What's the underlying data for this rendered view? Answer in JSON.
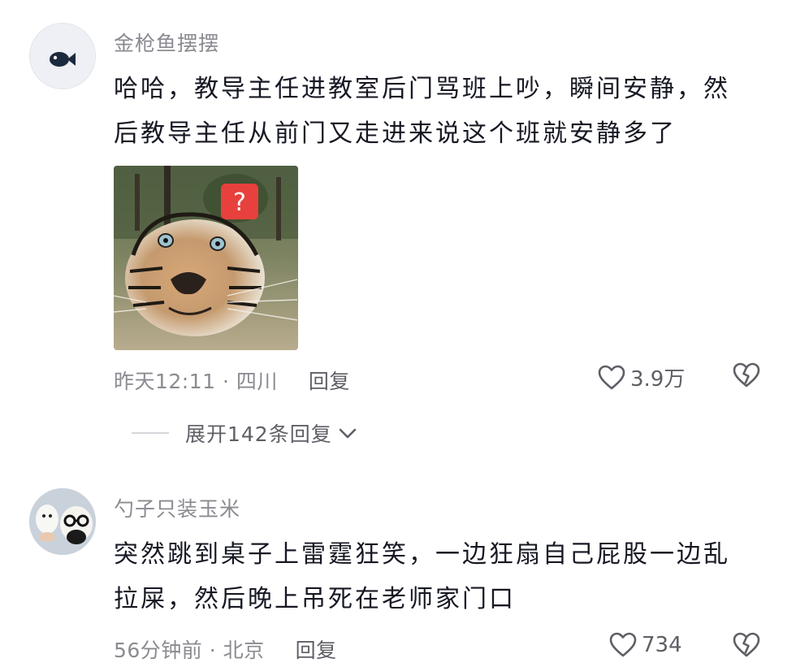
{
  "comments": [
    {
      "username": "金枪鱼摆摆",
      "text_line1": "哈哈，教导主任进教室后门骂班上吵，瞬间安静，然",
      "text_line2": "后教导主任从前门又走进来说这个班就安静多了",
      "sticker_badge": "?",
      "time_location": "昨天12:11 · 四川",
      "reply_label": "回复",
      "likes": "3.9万",
      "expand_replies": "展开142条回复"
    },
    {
      "username": "勺子只装玉米",
      "text_line1": "突然跳到桌子上雷霆狂笑，一边狂扇自己屁股一边乱",
      "text_line2": "拉屎，然后晚上吊死在老师家门口",
      "time_location": "56分钟前 · 北京",
      "reply_label": "回复",
      "likes": "734"
    }
  ],
  "colors": {
    "badge": "#e8403c",
    "meta": "#8a8b91"
  },
  "icons": [
    "fish-avatar-icon",
    "heart-icon",
    "broken-heart-icon",
    "chevron-down-icon"
  ]
}
